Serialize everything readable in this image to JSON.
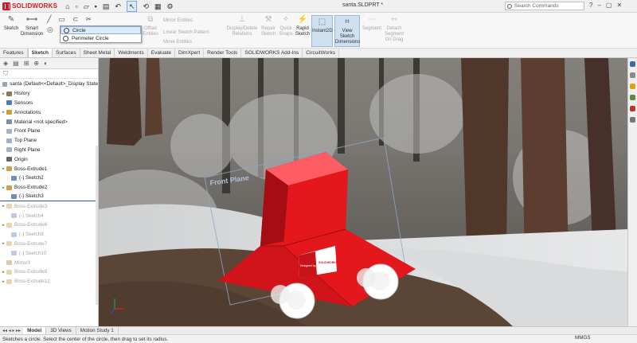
{
  "app": {
    "brand": "SOLIDWORKS",
    "document_title": "santa.SLDPRT *",
    "search_placeholder": "Search Commands"
  },
  "command_manager": {
    "sketch": "Sketch",
    "smart_dimension": [
      "Smart",
      "Dimension"
    ],
    "offset_entities": [
      "Offset",
      "Entities"
    ],
    "mirror_entities": "Mirror Entities",
    "linear_sketch_pattern": "Linear Sketch Pattern",
    "move_entities": "Move Entities",
    "display_delete_relations": [
      "Display/Delete",
      "Relations"
    ],
    "repair_sketch": [
      "Repair",
      "Sketch"
    ],
    "quick_snaps": [
      "Quick",
      "Snaps"
    ],
    "rapid_sketch": [
      "Rapid",
      "Sketch"
    ],
    "instant2d": "Instant2D",
    "view_sketch_dimensions": [
      "View",
      "Sketch",
      "Dimensions"
    ],
    "segment": "Segment",
    "detach_segment": [
      "Detach",
      "Segment",
      "On Drag"
    ]
  },
  "circle_flyout": [
    "Circle",
    "Perimeter Circle"
  ],
  "tabs": [
    "Features",
    "Sketch",
    "Surfaces",
    "Sheet Metal",
    "Weldments",
    "Evaluate",
    "DimXpert",
    "Render Tools",
    "SOLIDWORKS Add-Ins",
    "CircuitWorks"
  ],
  "active_tab": "Sketch",
  "feature_tree": {
    "root": "santa  (Default<<Default>_Display State",
    "items": [
      {
        "label": "History",
        "icon": "history-icon",
        "indent": 1,
        "expandable": true
      },
      {
        "label": "Sensors",
        "icon": "sensor-icon",
        "indent": 1,
        "expandable": false
      },
      {
        "label": "Annotations",
        "icon": "annotation-icon",
        "indent": 1,
        "expandable": true
      },
      {
        "label": "Material <not specified>",
        "icon": "material-icon",
        "indent": 1,
        "expandable": false
      },
      {
        "label": "Front Plane",
        "icon": "plane-icon",
        "indent": 1,
        "expandable": false
      },
      {
        "label": "Top Plane",
        "icon": "plane-icon",
        "indent": 1,
        "expandable": false
      },
      {
        "label": "Right Plane",
        "icon": "plane-icon",
        "indent": 1,
        "expandable": false
      },
      {
        "label": "Origin",
        "icon": "origin-icon",
        "indent": 1,
        "expandable": false
      },
      {
        "label": "Boss-Extrude1",
        "icon": "extrude-icon",
        "indent": 1,
        "expandable": true
      },
      {
        "label": "(-) Sketch2",
        "icon": "sketch-icon",
        "indent": 2,
        "expandable": false
      },
      {
        "label": "Boss-Extrude2",
        "icon": "extrude-icon",
        "indent": 1,
        "expandable": true
      },
      {
        "label": "(-) Sketch3",
        "icon": "sketch-icon",
        "indent": 2,
        "expandable": false
      },
      {
        "label": "Boss-Extrude3",
        "icon": "extrude-icon",
        "indent": 1,
        "expandable": true,
        "faded": true
      },
      {
        "label": "(-) Sketch4",
        "icon": "sketch-icon",
        "indent": 2,
        "expandable": false,
        "faded": true
      },
      {
        "label": "Boss-Extrude6",
        "icon": "extrude-icon",
        "indent": 1,
        "expandable": true,
        "faded": true
      },
      {
        "label": "(-) Sketch9",
        "icon": "sketch-icon",
        "indent": 2,
        "expandable": false,
        "faded": true
      },
      {
        "label": "Boss-Extrude7",
        "icon": "extrude-icon",
        "indent": 1,
        "expandable": true,
        "faded": true
      },
      {
        "label": "(-) Sketch10",
        "icon": "sketch-icon",
        "indent": 2,
        "expandable": false,
        "faded": true
      },
      {
        "label": "Mirror3",
        "icon": "mirror-icon",
        "indent": 1,
        "expandable": false,
        "faded": true
      },
      {
        "label": "Boss-Extrude8",
        "icon": "extrude-icon",
        "indent": 1,
        "expandable": true,
        "faded": true
      },
      {
        "label": "Boss-Extrude12",
        "icon": "extrude-icon",
        "indent": 1,
        "expandable": true,
        "faded": true
      }
    ]
  },
  "viewport": {
    "plane_label": "Front Plane",
    "decal_texts": [
      "Designed by",
      "SOLIDWORKS"
    ],
    "model_color": "#e3171c"
  },
  "bottom_tabs": [
    "Model",
    "3D Views",
    "Motion Study 1"
  ],
  "status_text": "Sketches a circle. Select the center of the circle, then drag to set its radius.",
  "units": "MMGS",
  "colors": {
    "accent": "#d71920",
    "selection": "#dcebfa"
  }
}
